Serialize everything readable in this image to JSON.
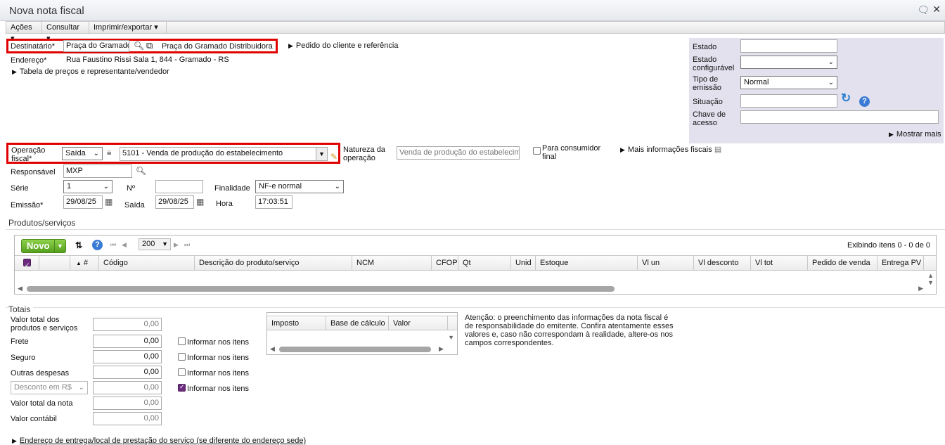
{
  "window": {
    "title": "Nova nota fiscal"
  },
  "menu": {
    "items": [
      "Ações",
      "Consultar",
      "Imprimir/exportar"
    ]
  },
  "destinatario": {
    "label": "Destinatário*",
    "value": "Praça do Gramado",
    "link_label": "Praça do Gramado Distribuidora",
    "pedido_label": "Pedido do cliente e referência"
  },
  "endereco": {
    "label": "Endereço*",
    "value": "Rua Faustino Rissi Sala 1, 844 - Gramado - RS"
  },
  "tabela_label": "Tabela de preços e representante/vendedor",
  "right_panel": {
    "estado_label": "Estado",
    "estado_config_label": "Estado configurável",
    "tipo_emissao_label": "Tipo de emissão",
    "tipo_emissao_value": "Normal",
    "situacao_label": "Situação",
    "chave_label": "Chave de acesso",
    "mostrar_mais": "Mostrar mais"
  },
  "operacao": {
    "label": "Operação fiscal*",
    "tipo": "Saída",
    "cfop": "5101 - Venda de produção do estabelecimento",
    "natureza_label": "Natureza da operação",
    "natureza_value": "Venda de produção do estabelecime",
    "consumidor_label": "Para consumidor final",
    "mais_info": "Mais informações fiscais"
  },
  "responsavel": {
    "label": "Responsável",
    "value": "MXP"
  },
  "serie": {
    "label": "Série",
    "value": "1"
  },
  "numero": {
    "label": "Nº",
    "value": ""
  },
  "finalidade": {
    "label": "Finalidade",
    "value": "NF-e normal"
  },
  "emissao": {
    "label": "Emissão*",
    "value": "29/08/25"
  },
  "saida": {
    "label": "Saída",
    "value": "29/08/25"
  },
  "hora": {
    "label": "Hora",
    "value": "17:03:51"
  },
  "produtos": {
    "section_title": "Produtos/serviços",
    "novo_label": "Novo",
    "page_size": "200",
    "exibindo": "Exibindo itens 0 - 0 de 0",
    "columns": [
      "#",
      "Código",
      "Descrição do produto/serviço",
      "NCM",
      "CFOP",
      "Qt",
      "Unid",
      "Estoque",
      "Vl un",
      "Vl desconto",
      "Vl tot",
      "Pedido de venda",
      "Entrega PV"
    ]
  },
  "totais": {
    "section_title": "Totais",
    "valor_total_produtos_label": "Valor total dos produtos e serviços",
    "valor_total_produtos": "0,00",
    "frete_label": "Frete",
    "frete": "0,00",
    "seguro_label": "Seguro",
    "seguro": "0,00",
    "outras_label": "Outras despesas",
    "outras": "0,00",
    "desconto_select": "Desconto em R$",
    "desconto": "0,00",
    "valor_total_nota_label": "Valor total da nota",
    "valor_total_nota": "0,00",
    "valor_contabil_label": "Valor contábil",
    "valor_contabil": "0,00",
    "informar_label": "Informar nos itens"
  },
  "impostos": {
    "columns": [
      "Imposto",
      "Base de cálculo",
      "Valor"
    ]
  },
  "atencao": "Atenção: o preenchimento das informações da nota fiscal é de responsabilidade do emitente. Confira atentamente esses valores e, caso não correspondam à realidade, altere-os nos campos correspondentes.",
  "endereco_entrega": "Endereço de entrega/local de prestação do serviço (se diferente do endereço sede)"
}
